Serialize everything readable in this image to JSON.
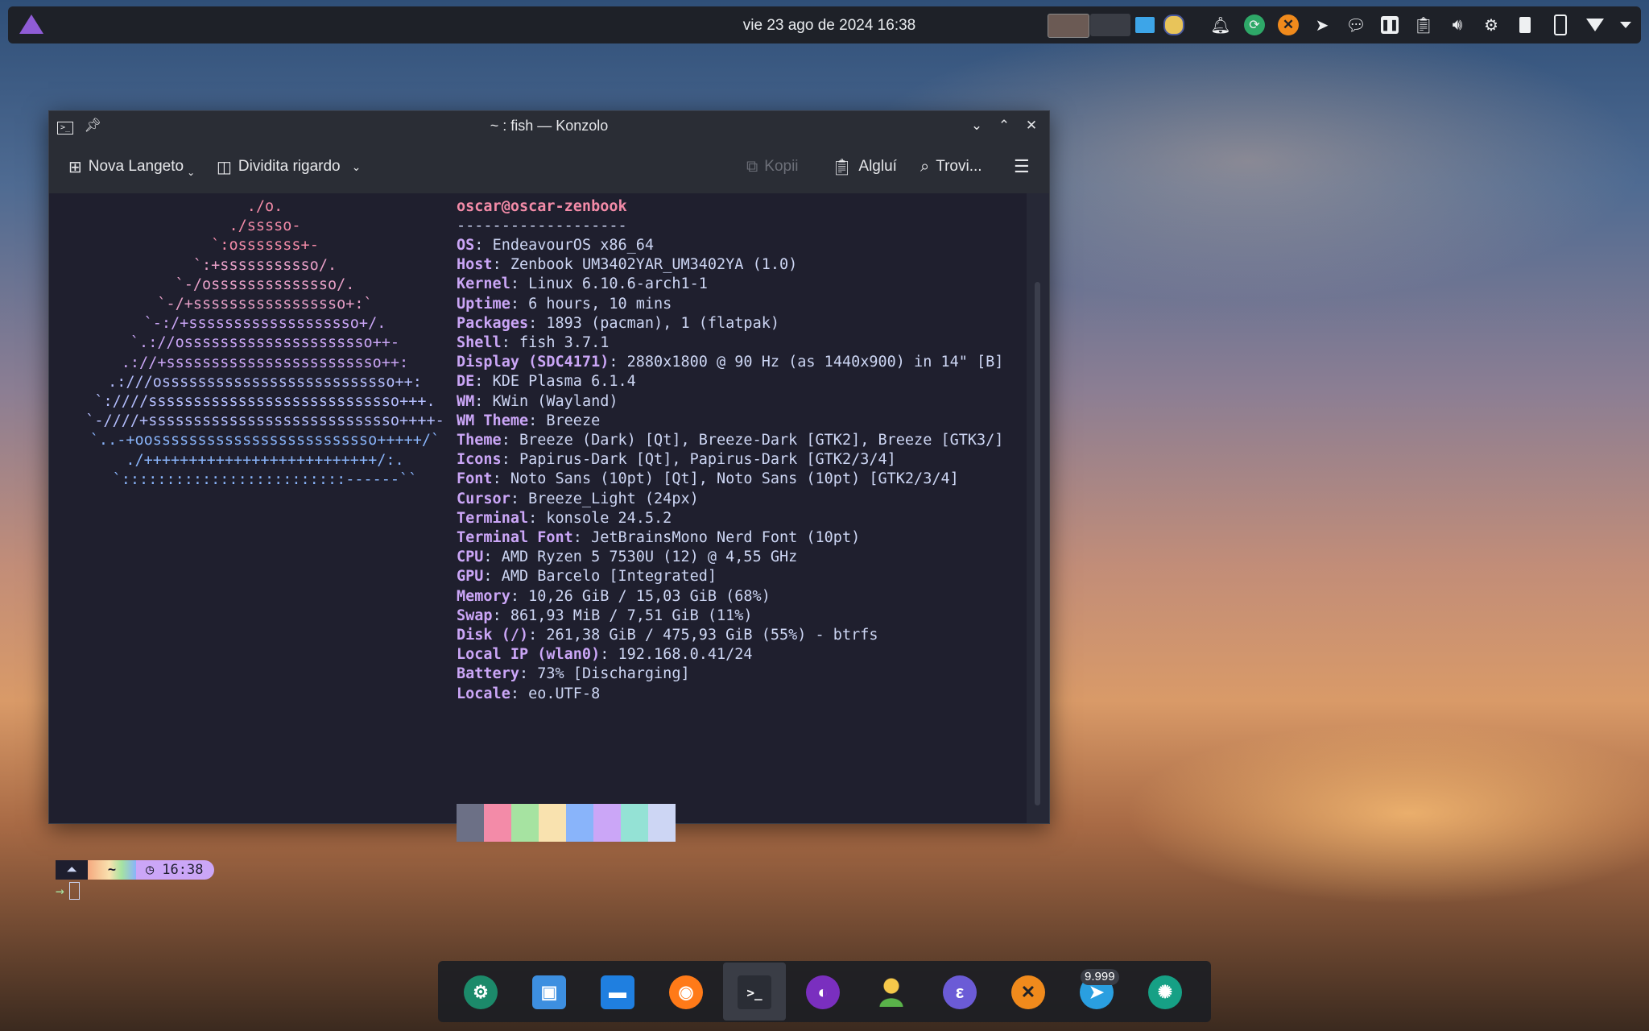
{
  "panel": {
    "clock": "vie 23 ago de 2024 16:38"
  },
  "window": {
    "title": "~ : fish — Konzolo",
    "toolbar": {
      "new_tab": "Nova Langeto",
      "split_view": "Dividita rigardo",
      "copy": "Kopii",
      "paste": "Algluí",
      "find": "Trovi..."
    }
  },
  "fastfetch": {
    "logo_lines": [
      "./o.",
      "./sssso-",
      "`:osssssss+-",
      "`:+sssssssssso/.",
      "`-/ossssssssssssso/.",
      "`-/+sssssssssssssssso+:`",
      "`-:/+sssssssssssssssssso+/.",
      "`.://osssssssssssssssssssso++-",
      ".://+ssssssssssssssssssssssso++:",
      ".:///ossssssssssssssssssssssssso++:",
      "`:////ssssssssssssssssssssssssssso+++.",
      "`-////+ssssssssssssssssssssssssssso++++-",
      "`..-+oosssssssssssssssssssssssso+++++/`",
      "./++++++++++++++++++++++++++/:.",
      "`:::::::::::::::::::::::::------``"
    ],
    "user_host": "oscar@oscar-zenbook",
    "separator": "-------------------",
    "info": [
      {
        "key": "OS",
        "value": "EndeavourOS x86_64"
      },
      {
        "key": "Host",
        "value": "Zenbook UM3402YAR_UM3402YA (1.0)"
      },
      {
        "key": "Kernel",
        "value": "Linux 6.10.6-arch1-1"
      },
      {
        "key": "Uptime",
        "value": "6 hours, 10 mins"
      },
      {
        "key": "Packages",
        "value": "1893 (pacman), 1 (flatpak)"
      },
      {
        "key": "Shell",
        "value": "fish 3.7.1"
      },
      {
        "key": "Display (SDC4171)",
        "value": "2880x1800 @ 90 Hz (as 1440x900) in 14\" [B]"
      },
      {
        "key": "DE",
        "value": "KDE Plasma 6.1.4"
      },
      {
        "key": "WM",
        "value": "KWin (Wayland)"
      },
      {
        "key": "WM Theme",
        "value": "Breeze"
      },
      {
        "key": "Theme",
        "value": "Breeze (Dark) [Qt], Breeze-Dark [GTK2], Breeze [GTK3/]"
      },
      {
        "key": "Icons",
        "value": "Papirus-Dark [Qt], Papirus-Dark [GTK2/3/4]"
      },
      {
        "key": "Font",
        "value": "Noto Sans (10pt) [Qt], Noto Sans (10pt) [GTK2/3/4]"
      },
      {
        "key": "Cursor",
        "value": "Breeze_Light (24px)"
      },
      {
        "key": "Terminal",
        "value": "konsole 24.5.2"
      },
      {
        "key": "Terminal Font",
        "value": "JetBrainsMono Nerd Font (10pt)"
      },
      {
        "key": "CPU",
        "value": "AMD Ryzen 5 7530U (12) @ 4,55 GHz"
      },
      {
        "key": "GPU",
        "value": "AMD Barcelo [Integrated]"
      },
      {
        "key": "Memory",
        "value": "10,26 GiB / 15,03 GiB (68%)"
      },
      {
        "key": "Swap",
        "value": "861,93 MiB / 7,51 GiB (11%)"
      },
      {
        "key": "Disk (/)",
        "value": "261,38 GiB / 475,93 GiB (55%) - btrfs"
      },
      {
        "key": "Local IP (wlan0)",
        "value": "192.168.0.41/24"
      },
      {
        "key": "Battery",
        "value": "73% [Discharging]"
      },
      {
        "key": "Locale",
        "value": "eo.UTF-8"
      }
    ],
    "palette": [
      "#6c7086",
      "#f38ba8",
      "#a6e3a1",
      "#f9e2af",
      "#89b4fa",
      "#cba6f7",
      "#94e2d5",
      "#cdd6f4"
    ]
  },
  "prompt": {
    "dir": "~",
    "time": "16:38",
    "arrow": "→"
  },
  "dock": {
    "badge": "9.999"
  }
}
